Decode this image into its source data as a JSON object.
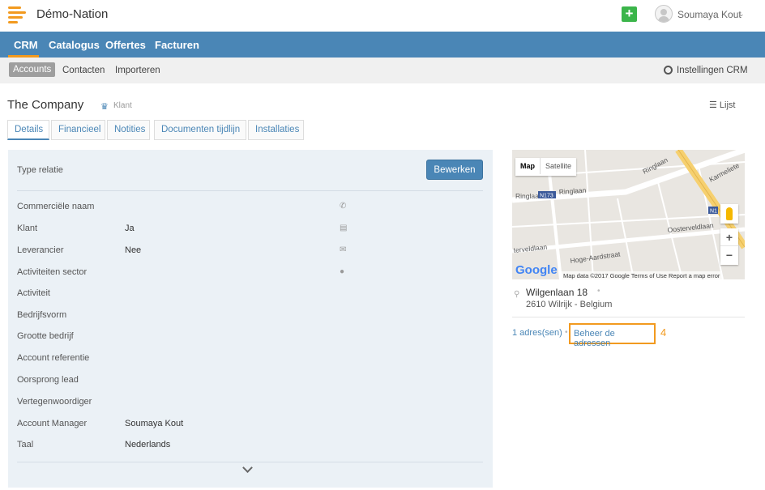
{
  "app": {
    "title": "Démo-Nation",
    "add_label": "+"
  },
  "user": {
    "name": "Soumaya Kout",
    "chevron": "⌄"
  },
  "main_nav": {
    "items": [
      "CRM",
      "Catalogus",
      "Offertes",
      "Facturen"
    ],
    "active": "CRM"
  },
  "sub_nav": {
    "items": [
      "Accounts",
      "Contacten",
      "Importeren"
    ],
    "active": "Accounts",
    "settings_label": "Instellingen CRM"
  },
  "header": {
    "company": "The Company",
    "type_tag": "Klant",
    "list_label": "Lijst"
  },
  "tabs": [
    "Details",
    "Financieel",
    "Notities",
    "Documenten tijdlijn",
    "Installaties"
  ],
  "details": {
    "type_label": "Type relatie",
    "edit_label": "Bewerken",
    "fields": [
      {
        "label": "Commerciële naam",
        "value": ""
      },
      {
        "label": "Klant",
        "value": "Ja"
      },
      {
        "label": "Leverancier",
        "value": "Nee"
      },
      {
        "label": "Activiteiten sector",
        "value": ""
      },
      {
        "label": "Activiteit",
        "value": ""
      },
      {
        "label": "Bedrijfsvorm",
        "value": ""
      },
      {
        "label": "Grootte bedrijf",
        "value": ""
      },
      {
        "label": "Account referentie",
        "value": ""
      },
      {
        "label": "Oorsprong lead",
        "value": ""
      },
      {
        "label": "Vertegenwoordiger",
        "value": ""
      },
      {
        "label": "Account Manager",
        "value": "Soumaya Kout"
      },
      {
        "label": "Taal",
        "value": "Nederlands"
      }
    ],
    "contact_icons": [
      "phone-icon",
      "fax-icon",
      "email-icon",
      "globe-icon"
    ]
  },
  "map": {
    "map_label": "Map",
    "satellite_label": "Satellite",
    "streets": [
      "Ringlaan",
      "Ringlaan",
      "N173",
      "Ringlaan",
      "Karmeliete",
      "N1",
      "Oosterveldlaan",
      "terveldlaan",
      "Hoge-Aardstraat"
    ],
    "google": "Google",
    "credits": "Map data ©2017 Google    Terms of Use    Report a map error",
    "zoom_in": "+",
    "zoom_out": "−"
  },
  "address": {
    "street": "Wilgenlaan 18",
    "city": "2610 Wilrijk - Belgium",
    "count_label": "1 adres(sen)",
    "manage_label": "Beheer de adressen",
    "annotation": "4"
  },
  "colors": {
    "accent": "#4a86b6",
    "highlight": "#f29a1f",
    "add": "#3bb54a",
    "panel": "#ebf1f6"
  }
}
